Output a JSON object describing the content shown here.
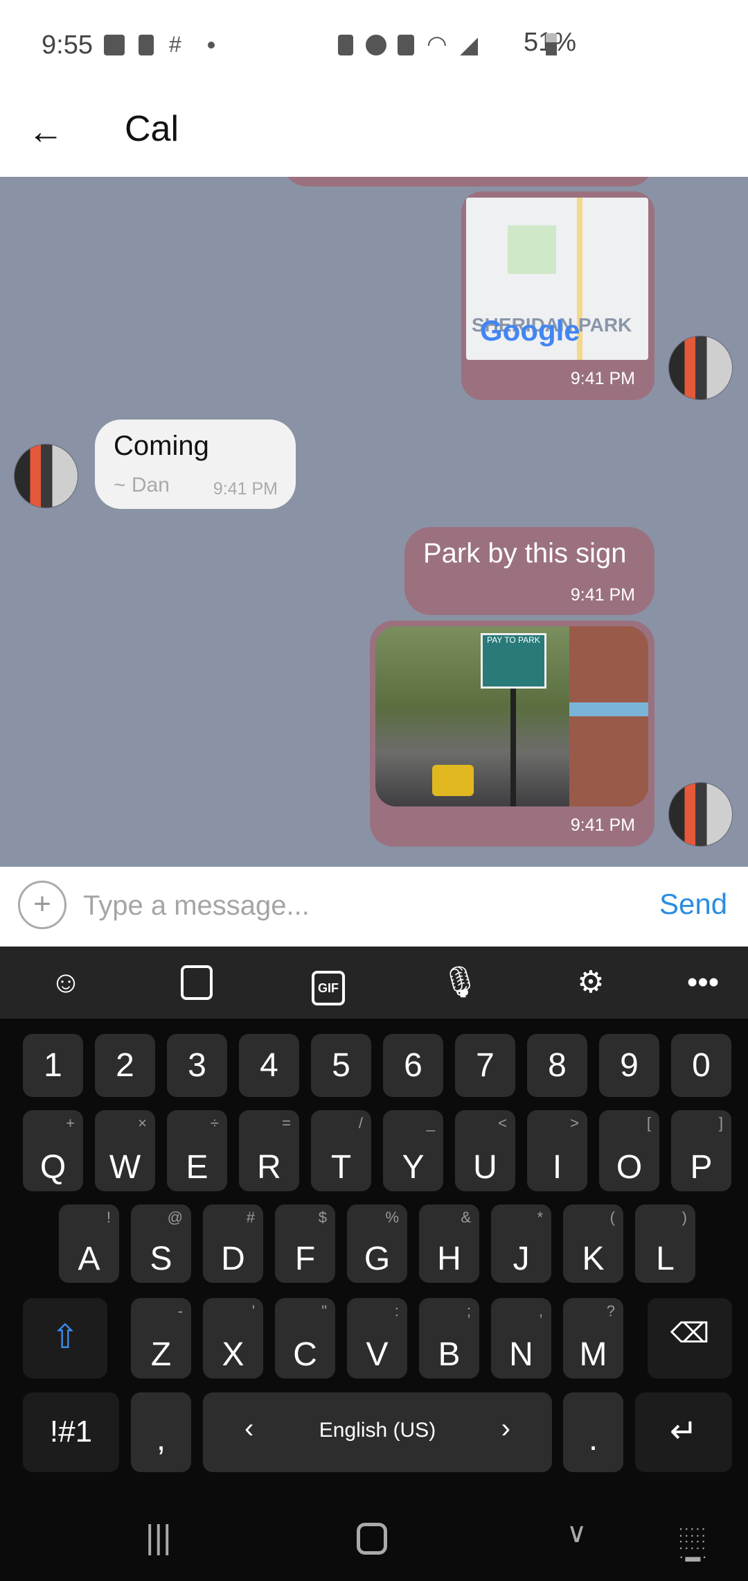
{
  "status_bar": {
    "time": "9:55",
    "battery": "51%",
    "icons": [
      "gallery-icon",
      "speaker-icon",
      "slack-icon",
      "dot-icon",
      "battery-saver-icon",
      "alarm-icon",
      "mute-icon",
      "wifi-icon",
      "signal-icon",
      "battery-icon"
    ]
  },
  "header": {
    "title": "Cal",
    "back_icon": "arrow-left-icon"
  },
  "messages": [
    {
      "type": "map",
      "direction": "outgoing",
      "map_label": "SHERIDAN PARK",
      "logo": "Google",
      "time": "9:41 PM"
    },
    {
      "type": "text",
      "direction": "incoming",
      "text": "Coming",
      "sender": "~ Dan",
      "time": "9:41 PM"
    },
    {
      "type": "text",
      "direction": "outgoing",
      "text": "Park by this sign",
      "time": "9:41 PM"
    },
    {
      "type": "image",
      "direction": "outgoing",
      "sign_text": "PAY TO PARK",
      "time": "9:41 PM"
    }
  ],
  "input": {
    "placeholder": "Type a message...",
    "send_label": "Send"
  },
  "keyboard": {
    "toolbar": [
      "emoji-icon",
      "sticker-icon",
      "gif-icon",
      "microphone-icon",
      "settings-icon",
      "more-icon"
    ],
    "gif_label": "GIF",
    "rows": [
      [
        [
          "1",
          ""
        ],
        [
          "2",
          ""
        ],
        [
          "3",
          ""
        ],
        [
          "4",
          ""
        ],
        [
          "5",
          ""
        ],
        [
          "6",
          ""
        ],
        [
          "7",
          ""
        ],
        [
          "8",
          ""
        ],
        [
          "9",
          ""
        ],
        [
          "0",
          ""
        ]
      ],
      [
        [
          "Q",
          "+"
        ],
        [
          "W",
          "×"
        ],
        [
          "E",
          "÷"
        ],
        [
          "R",
          "="
        ],
        [
          "T",
          "/"
        ],
        [
          "Y",
          "_"
        ],
        [
          "U",
          "<"
        ],
        [
          "I",
          ">"
        ],
        [
          "O",
          "["
        ],
        [
          "P",
          "]"
        ]
      ],
      [
        [
          "A",
          "!"
        ],
        [
          "S",
          "@"
        ],
        [
          "D",
          "#"
        ],
        [
          "F",
          "$"
        ],
        [
          "G",
          "%"
        ],
        [
          "H",
          "&"
        ],
        [
          "J",
          "*"
        ],
        [
          "K",
          "("
        ],
        [
          "L",
          ")"
        ]
      ],
      [
        [
          "Z",
          "-"
        ],
        [
          "X",
          "'"
        ],
        [
          "C",
          "\""
        ],
        [
          "V",
          ":"
        ],
        [
          "B",
          ";"
        ],
        [
          "N",
          ","
        ],
        [
          "M",
          "?"
        ]
      ]
    ],
    "symbols_label": "!#1",
    "comma": ",",
    "period": ".",
    "language": "English (US)",
    "lang_prev": "‹",
    "lang_next": "›"
  },
  "colors": {
    "chat_bg": "#8993a5",
    "outgoing_bubble": "#9b717f",
    "incoming_bubble": "#f2f2f2",
    "accent": "#2b8de3"
  }
}
